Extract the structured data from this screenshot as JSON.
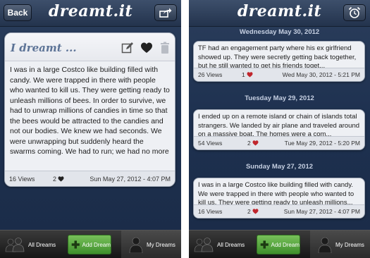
{
  "app": {
    "title": "dreamt.it"
  },
  "left_screen": {
    "back_label": "Back",
    "card": {
      "heading": "I dreamt ...",
      "text": "I was in a large Costco like building filled with candy. We were trapped in there with people who wanted to kill us. They were getting ready to unleash millions of bees. In order to survive, we had to unwrap millions of candies in time so that the bees would be attracted to the candies and not our bodies. We knew we had seconds. We were unwrapping but suddenly heard the swarms coming. We had to run; we had no more",
      "views": "16 Views",
      "likes": "2",
      "date": "Sun May 27, 2012 - 4:07 PM"
    }
  },
  "right_screen": {
    "sections": [
      {
        "date_header": "Wednesday May 30, 2012",
        "text": "TF had an engagement party where his ex girlfriend showed up. They were secretly getting back together, but he still wanted to get his friends toget...",
        "views": "26 Views",
        "likes": "1",
        "date": "Wed May 30, 2012 - 5:21 PM"
      },
      {
        "date_header": "Tuesday May 29, 2012",
        "text": "I ended up on a remote island or chain of islands total strangers. We landed by air plane and traveled around on a massive boat. The homes were a com...",
        "views": "54 Views",
        "likes": "2",
        "date": "Tue May 29, 2012 - 5:20 PM"
      },
      {
        "date_header": "Sunday May 27, 2012",
        "text": "I was in a large Costco like building filled with candy. We were trapped in there with people who wanted to kill us. They were getting ready to unleash millions...",
        "views": "16 Views",
        "likes": "2",
        "date": "Sun May 27, 2012 - 4:07 PM"
      }
    ]
  },
  "tabbar": {
    "all_dreams": "All Dreams",
    "add_dream": "Add Dream",
    "my_dreams": "My Dreams"
  },
  "colors": {
    "background_navy": "#1e3150",
    "card": "#eef0f4",
    "heading_blue": "#5c7396",
    "heart_red": "#c0262d",
    "add_green": "#4fa43a"
  }
}
